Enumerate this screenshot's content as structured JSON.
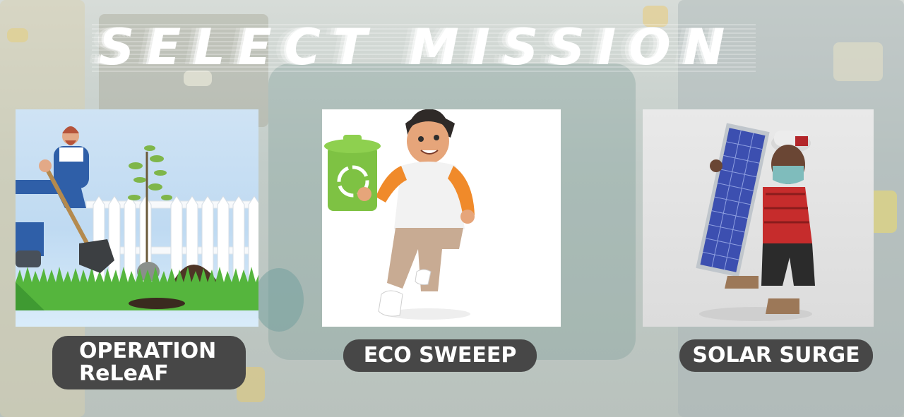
{
  "screen_title": "Select Mission",
  "missions": [
    {
      "label": "OPERATION ReLeAF",
      "label_line1": "OPERATION",
      "label_line2": "ReLeAF",
      "image": "gardener-planting-tree"
    },
    {
      "label": "ECO SWEEEP",
      "image": "boy-with-recycling-bin"
    },
    {
      "label": "SOLAR SURGE",
      "image": "worker-with-solar-panel"
    }
  ],
  "colors": {
    "label_bg": "#474747",
    "label_text": "#ffffff",
    "title_text": "#ffffff"
  }
}
